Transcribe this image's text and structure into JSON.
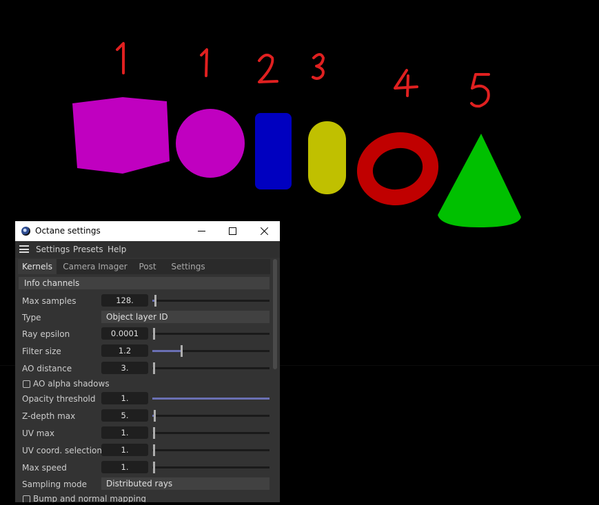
{
  "scene": {
    "annotations": [
      "1",
      "1",
      "2",
      "3",
      "4",
      "5"
    ],
    "shapes": [
      {
        "name": "cube",
        "color": "#c000c0"
      },
      {
        "name": "sphere",
        "color": "#c000c0"
      },
      {
        "name": "cylinder",
        "color": "#0000c0"
      },
      {
        "name": "capsule",
        "color": "#c0c000"
      },
      {
        "name": "torus",
        "color": "#c00000"
      },
      {
        "name": "cone",
        "color": "#00c000"
      }
    ],
    "annotation_color": "#e02020"
  },
  "window": {
    "title": "Octane settings",
    "icon": "octane-icon",
    "controls": [
      "minimize-icon",
      "maximize-icon",
      "close-icon"
    ]
  },
  "menu": {
    "icon": "hamburger-icon",
    "items": [
      "Settings",
      "Presets",
      "Help"
    ]
  },
  "tabs": [
    "Kernels",
    "Camera Imager",
    "Post",
    "Settings"
  ],
  "active_tab": "Kernels",
  "section": "Info channels",
  "fields": {
    "max_samples": {
      "label": "Max samples",
      "value": "128.",
      "level": 0.02
    },
    "type": {
      "label": "Type",
      "value": "Object layer ID"
    },
    "ray_epsilon": {
      "label": "Ray epsilon",
      "value": "0.0001",
      "level": 0.0
    },
    "filter_size": {
      "label": "Filter size",
      "value": "1.2",
      "level": 0.24
    },
    "ao_distance": {
      "label": "AO distance",
      "value": "3.",
      "level": 0.0
    },
    "ao_alpha_shadows": {
      "label": "AO alpha shadows",
      "checked": false
    },
    "opacity_threshold": {
      "label": "Opacity threshold",
      "value": "1.",
      "level": 1.0
    },
    "z_depth_max": {
      "label": "Z-depth max",
      "value": "5.",
      "level": 0.01
    },
    "uv_max": {
      "label": "UV max",
      "value": "1.",
      "level": 0.0
    },
    "uv_coord_selection": {
      "label": "UV coord. selection",
      "value": "1.",
      "level": 0.0
    },
    "max_speed": {
      "label": "Max speed",
      "value": "1.",
      "level": 0.0
    },
    "sampling_mode": {
      "label": "Sampling mode",
      "value": "Distributed rays"
    },
    "bump_normal_mapping": {
      "label": "Bump and normal mapping",
      "checked": false
    }
  }
}
